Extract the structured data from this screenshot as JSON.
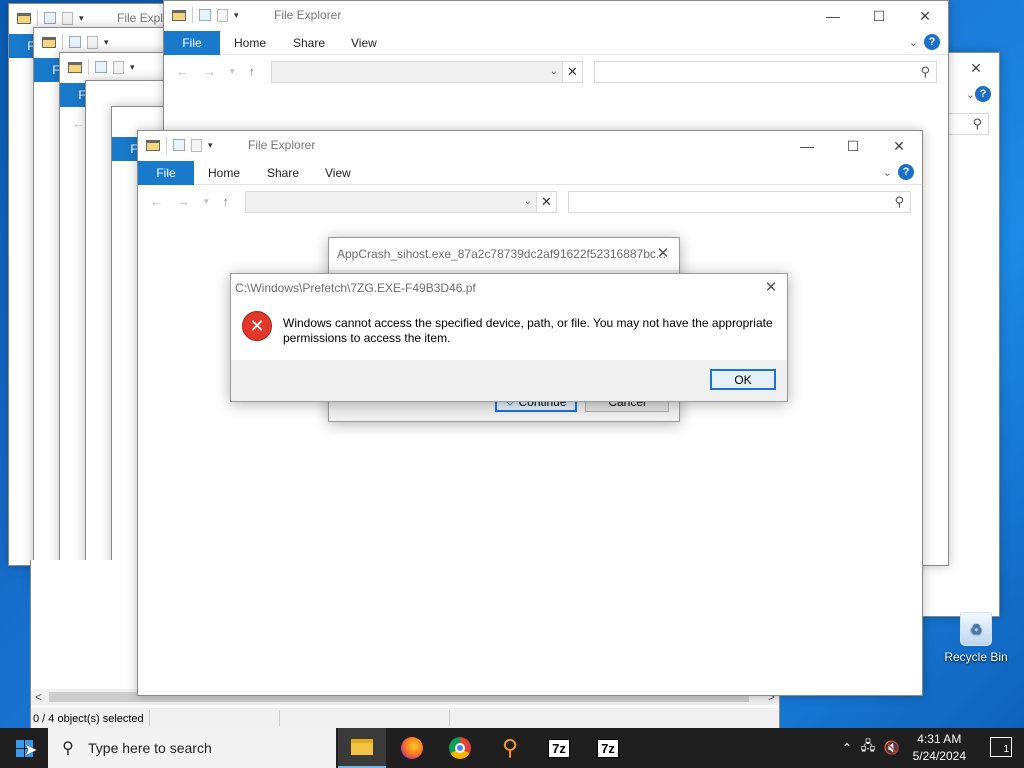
{
  "explorer": {
    "title": "File Explorer",
    "tabs": {
      "file": "File",
      "home": "Home",
      "share": "Share",
      "view": "View"
    },
    "help": "?",
    "truncated_title": "File Explo"
  },
  "bottom_window": {
    "status": "0 / 4 object(s) selected",
    "scroll_left": "<",
    "scroll_right": ">"
  },
  "uac_dialog": {
    "title": "AppCrash_sihost.exe_87a2c78739dc2af91622f52316887bc...",
    "continue_label": "Continue",
    "cancel_label": "Cancel"
  },
  "error_dialog": {
    "title": "C:\\Windows\\Prefetch\\7ZG.EXE-F49B3D46.pf",
    "message_line1": "Windows cannot access the specified device, path, or file. You may not have the appropriate",
    "message_line2": "permissions to access the item.",
    "ok_label": "OK"
  },
  "desktop": {
    "recycle_bin_label": "Recycle Bin"
  },
  "taskbar": {
    "search_placeholder": "Type here to search",
    "apps": [
      "file-explorer",
      "firefox",
      "chrome",
      "search-tool",
      "7-zip",
      "7-zip"
    ],
    "app_7z_label": "7z",
    "time": "4:31 AM",
    "date": "5/24/2024",
    "notification_count": "1"
  }
}
